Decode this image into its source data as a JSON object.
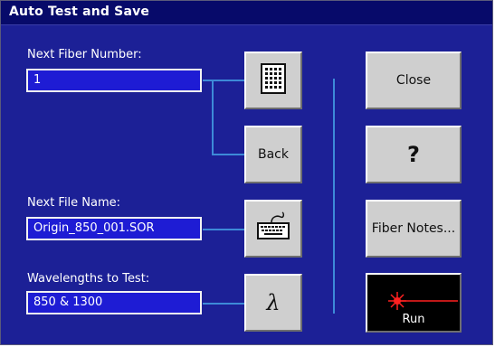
{
  "window": {
    "title": "Auto Test and Save"
  },
  "fiber": {
    "label": "Next Fiber Number:",
    "value": "1"
  },
  "file": {
    "label": "Next File Name:",
    "value": "Origin_850_001.SOR"
  },
  "wavelengths": {
    "label": "Wavelengths to Test:",
    "value": "850 & 1300"
  },
  "buttons": {
    "back": "Back",
    "close": "Close",
    "help": "?",
    "fiber_notes": "Fiber Notes...",
    "run": "Run",
    "lambda": "λ"
  },
  "icons": {
    "keypad": "keypad-icon",
    "keyboard": "keyboard-icon",
    "laser": "laser-icon"
  },
  "colors": {
    "background": "#1c2096",
    "title_bar": "#070a6a",
    "field": "#1e1cd4",
    "button": "#cfcfcf",
    "connector": "#3d8ad8",
    "laser": "#ff2020"
  }
}
